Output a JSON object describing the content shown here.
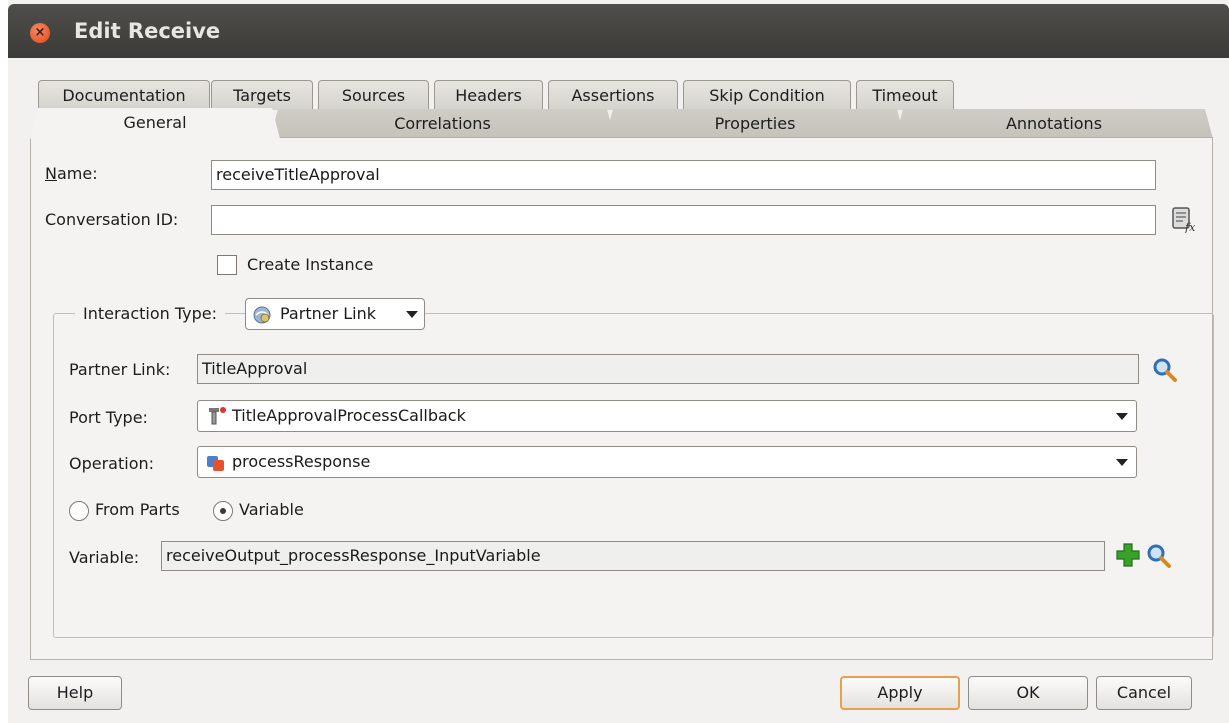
{
  "window": {
    "title": "Edit Receive",
    "close_icon": "close-icon"
  },
  "tabs": {
    "row1": [
      "Documentation",
      "Targets",
      "Sources",
      "Headers",
      "Assertions",
      "Skip Condition",
      "Timeout"
    ],
    "row2": [
      "General",
      "Correlations",
      "Properties",
      "Annotations"
    ],
    "active": "General"
  },
  "general": {
    "name_label": "Name:",
    "name_value": "receiveTitleApproval",
    "conversation_label": "Conversation ID:",
    "conversation_value": "",
    "create_instance_label": "Create Instance",
    "create_instance_checked": false,
    "interaction_type_label": "Interaction Type:",
    "interaction_type_value": "Partner Link",
    "partner_link_label": "Partner Link:",
    "partner_link_value": "TitleApproval",
    "port_type_label": "Port Type:",
    "port_type_value": "TitleApprovalProcessCallback",
    "operation_label": "Operation:",
    "operation_value": "processResponse",
    "from_parts_label": "From Parts",
    "variable_radio_label": "Variable",
    "selected_radio": "Variable",
    "variable_label": "Variable:",
    "variable_value": "receiveOutput_processResponse_InputVariable"
  },
  "buttons": {
    "help": "Help",
    "apply": "Apply",
    "ok": "OK",
    "cancel": "Cancel"
  },
  "colors": {
    "titlebar": "#3c3b37",
    "close": "#e0481d",
    "default_button_border": "#e7a14e",
    "add_icon": "#3aa12b",
    "search_icon": "#2f6fb5"
  }
}
